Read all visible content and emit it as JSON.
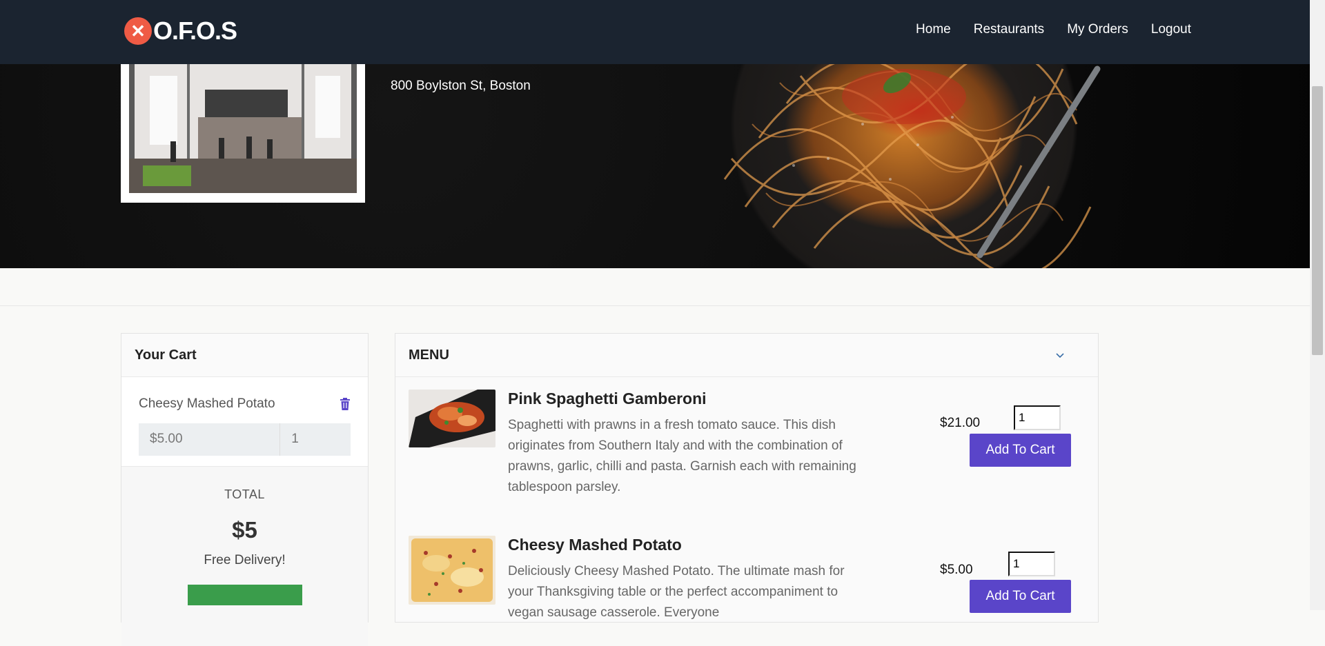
{
  "nav": {
    "brand": "O.F.O.S",
    "links": [
      "Home",
      "Restaurants",
      "My Orders",
      "Logout"
    ]
  },
  "restaurant": {
    "address": "800 Boylston St, Boston"
  },
  "cart": {
    "title": "Your Cart",
    "items": [
      {
        "name": "Cheesy Mashed Potato",
        "price": "$5.00",
        "qty": "1"
      }
    ],
    "total_label": "TOTAL",
    "total_amount": "$5",
    "delivery_note": "Free Delivery!"
  },
  "menu": {
    "title": "MENU",
    "items": [
      {
        "name": "Pink Spaghetti Gamberoni",
        "description": "Spaghetti with prawns in a fresh tomato sauce. This dish originates from Southern Italy and with the combination of prawns, garlic, chilli and pasta. Garnish each with remaining tablespoon parsley.",
        "price": "$21.00",
        "qty": "1",
        "button": "Add To Cart"
      },
      {
        "name": "Cheesy Mashed Potato",
        "description": "Deliciously Cheesy Mashed Potato. The ultimate mash for your Thanksgiving table or the perfect accompaniment to vegan sausage casserole. Everyone",
        "price": "$5.00",
        "qty": "1",
        "button": "Add To Cart"
      }
    ]
  },
  "colors": {
    "navbar": "#1b2430",
    "accent": "#5a45c9",
    "logo": "#ef5b45",
    "checkout": "#3a9d4b"
  }
}
